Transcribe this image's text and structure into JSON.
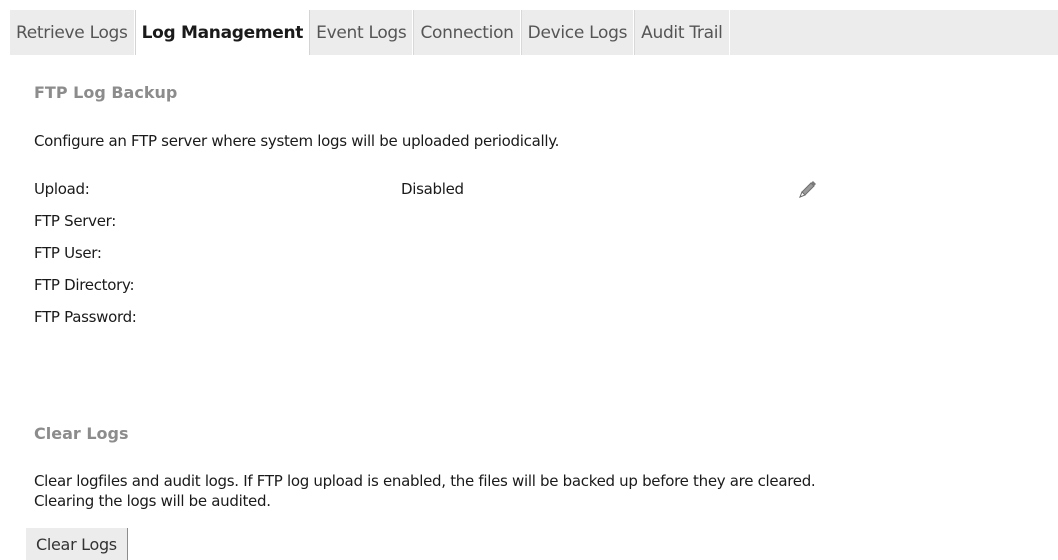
{
  "tabs": [
    {
      "label": "Retrieve Logs",
      "active": false
    },
    {
      "label": "Log Management",
      "active": true
    },
    {
      "label": "Event Logs",
      "active": false
    },
    {
      "label": "Connection",
      "active": false
    },
    {
      "label": "Device Logs",
      "active": false
    },
    {
      "label": "Audit Trail",
      "active": false
    }
  ],
  "ftp_backup": {
    "title": "FTP Log Backup",
    "description": "Configure an FTP server where system logs will be uploaded periodically.",
    "fields": [
      {
        "label": "Upload:",
        "value": "Disabled"
      },
      {
        "label": "FTP Server:",
        "value": ""
      },
      {
        "label": "FTP User:",
        "value": ""
      },
      {
        "label": "FTP Directory:",
        "value": ""
      },
      {
        "label": "FTP Password:",
        "value": ""
      }
    ],
    "edit_icon": "pencil-icon"
  },
  "clear_logs": {
    "title": "Clear Logs",
    "description_line1": "Clear logfiles and audit logs. If FTP log upload is enabled, the files will be backed up before they are cleared.",
    "description_line2": "Clearing the logs will be audited.",
    "button_label": "Clear Logs"
  }
}
